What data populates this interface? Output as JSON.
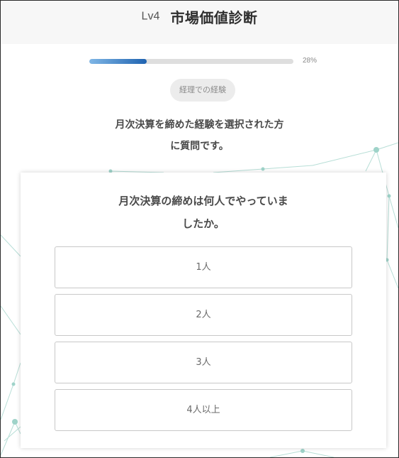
{
  "header": {
    "level": "Lv4",
    "title": "市場価値診断"
  },
  "progress": {
    "value": 0.28,
    "label": "28%"
  },
  "category": "経理での経験",
  "intro": {
    "line1": "月次決算を締めた経験を選択された方",
    "line2": "に質問です。"
  },
  "question": {
    "line1": "月次決算の締めは何人でやっていま",
    "line2": "したか。"
  },
  "options": [
    {
      "label": "1人"
    },
    {
      "label": "2人"
    },
    {
      "label": "3人"
    },
    {
      "label": "4人以上"
    }
  ],
  "colors": {
    "network": "#9fd3c9",
    "progress_start": "#7fb6e6",
    "progress_end": "#1f63b0"
  }
}
